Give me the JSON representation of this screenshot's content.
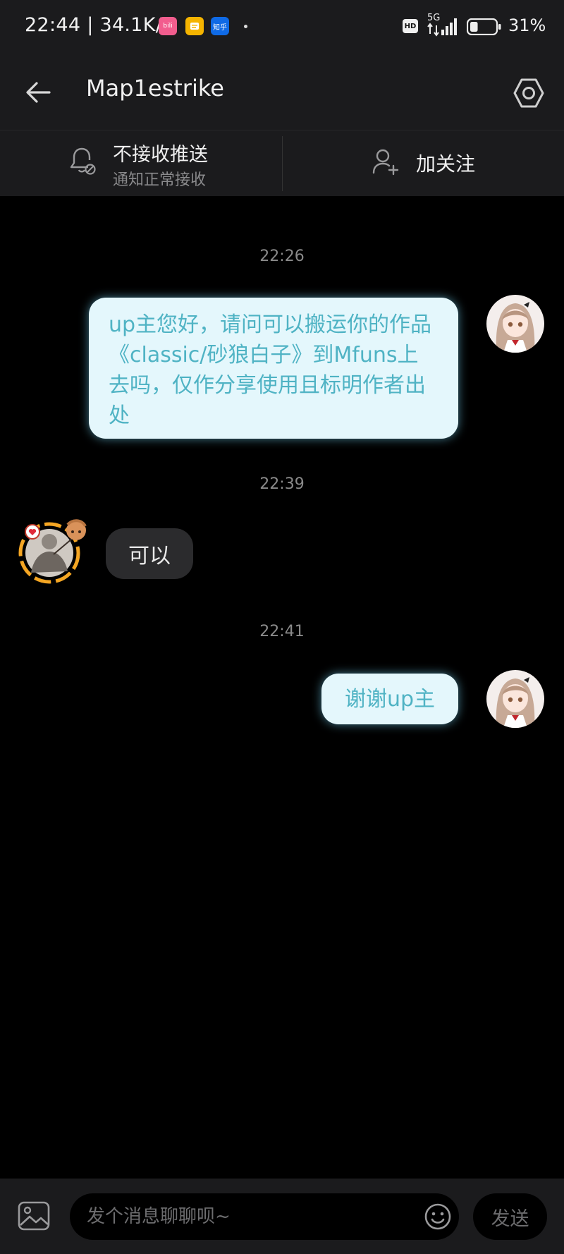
{
  "status_bar": {
    "time_speed": "22:44 | 34.1K/s",
    "app_icons": [
      {
        "name": "bilibili-icon",
        "label": "bili",
        "color": "#f25d8e"
      },
      {
        "name": "notes-icon",
        "label": "",
        "color": "#f5b400"
      },
      {
        "name": "zhihu-icon",
        "label": "知乎",
        "color": "#0f6ae6"
      }
    ],
    "hd_label": "HD",
    "network_label": "5G",
    "battery_percent": "31%",
    "battery_level": 0.31
  },
  "header": {
    "title": "Map1estrike"
  },
  "actions": {
    "notify_title": "不接收推送",
    "notify_subtitle": "通知正常接收",
    "follow_label": "加关注"
  },
  "messages": [
    {
      "timestamp": "22:26",
      "sender": "me",
      "text": "up主您好，请问可以搬运你的作品《classic/砂狼白子》到Mfuns上去吗，仅作分享使用且标明作者出处"
    },
    {
      "timestamp": "22:39",
      "sender": "other",
      "text": "可以"
    },
    {
      "timestamp": "22:41",
      "sender": "me",
      "text": "谢谢up主"
    }
  ],
  "input": {
    "placeholder": "发个消息聊聊呗~",
    "send_label": "发送"
  },
  "colors": {
    "bar_bg": "#1b1b1d",
    "outgoing_bubble": "#e4f7fc",
    "outgoing_text": "#4fb3c4",
    "incoming_bubble": "#2b2b2d",
    "avatar_ring": "#f5a623"
  }
}
